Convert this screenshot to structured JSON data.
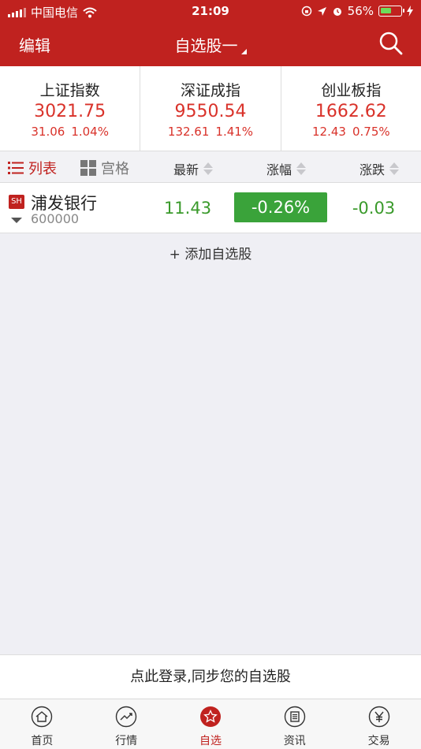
{
  "status_bar": {
    "carrier": "中国电信",
    "time": "21:09",
    "battery": "56%",
    "battery_level": 0.56
  },
  "nav": {
    "edit_label": "编辑",
    "title": "自选股一"
  },
  "indices": [
    {
      "name": "上证指数",
      "value": "3021.75",
      "change": "31.06",
      "pct": "1.04%"
    },
    {
      "name": "深证成指",
      "value": "9550.54",
      "change": "132.61",
      "pct": "1.41%"
    },
    {
      "name": "创业板指",
      "value": "1662.62",
      "change": "12.43",
      "pct": "0.75%"
    }
  ],
  "list_header": {
    "list_view": "列表",
    "grid_view": "宫格",
    "col_latest": "最新",
    "col_pct": "涨幅",
    "col_change": "涨跌"
  },
  "stocks": [
    {
      "market": "SH",
      "name": "浦发银行",
      "code": "600000",
      "price": "11.43",
      "pct": "-0.26%",
      "change": "-0.03"
    }
  ],
  "add_label": "+ 添加自选股",
  "login_prompt": "点此登录,同步您的自选股",
  "tabs": [
    {
      "label": "首页",
      "icon": "home-icon"
    },
    {
      "label": "行情",
      "icon": "trend-icon"
    },
    {
      "label": "自选",
      "icon": "star-icon",
      "active": true
    },
    {
      "label": "资讯",
      "icon": "news-icon"
    },
    {
      "label": "交易",
      "icon": "yen-icon"
    }
  ],
  "colors": {
    "brand_red": "#c0221f",
    "up_red": "#d9322a",
    "down_green": "#3a9a2b"
  }
}
